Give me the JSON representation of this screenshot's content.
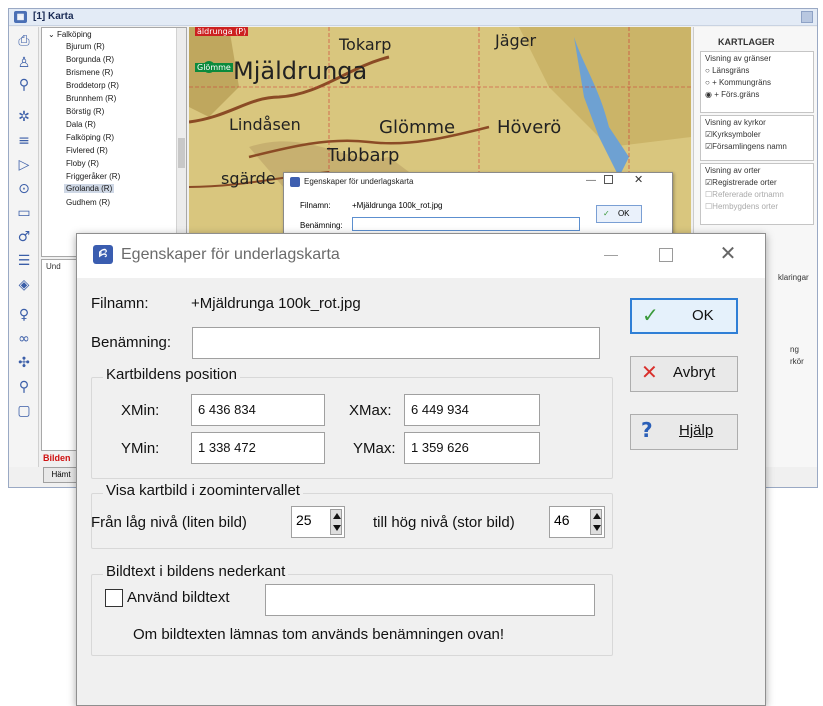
{
  "background_window": {
    "title": "[1] Karta",
    "tree": {
      "parent": "Falköping",
      "items": [
        "Bjurum (R)",
        "Borgunda (R)",
        "Brismene (R)",
        "Broddetorp (R)",
        "Brunnhem (R)",
        "Börstig (R)",
        "Dala (R)",
        "Falköping (R)",
        "Fivlered (R)",
        "Floby (R)",
        "Friggeråker (R)",
        "Grolanda (R)",
        "Gudhem (R)"
      ],
      "selected": "Grolanda (R)"
    },
    "panel2_label": "Und",
    "bottom_red_text": "Bilden",
    "hamta_button": "Hämt",
    "map_labels": [
      "äldrunga (P)",
      "Glömme",
      "Mjäldrunga",
      "Tokarp",
      "Jäger",
      "Lindåsen",
      "Glömme",
      "Höverö",
      "Tubbarp",
      "sgärde"
    ],
    "right_panel": {
      "heading": "KARTLAGER",
      "section1_title": "Visning av gränser",
      "radios": [
        "Länsgräns",
        "+ Kommungräns",
        "+ Förs.gräns"
      ],
      "radio_selected_index": 2,
      "section2_title": "Visning av kyrkor",
      "church_checks": [
        "Kyrksymboler",
        "Församlingens namn"
      ],
      "section3_title": "Visning av orter",
      "place_checks": [
        "Registrerade orter",
        "Refererade ortnamn",
        "Hembygdens orter"
      ],
      "truncated_1": "klaringar",
      "truncated_2": "ng",
      "truncated_3": "rkör"
    }
  },
  "small_dialog": {
    "title": "Egenskaper för underlagskarta",
    "filnamn_label": "Filnamn:",
    "filnamn_value": "+Mjäldrunga 100k_rot.jpg",
    "benamning_label": "Benämning:",
    "ok_label": "OK"
  },
  "dialog": {
    "title": "Egenskaper för underlagskarta",
    "app_icon": "ꗲ",
    "filnamn_label": "Filnamn:",
    "filnamn_value": "+Mjäldrunga 100k_rot.jpg",
    "benamning_label": "Benämning:",
    "benamning_value": "",
    "position_group": "Kartbildens position",
    "xmin_label": "XMin:",
    "xmin_value": "6 436 834",
    "xmax_label": "XMax:",
    "xmax_value": "6 449 934",
    "ymin_label": "YMin:",
    "ymin_value": "1 338 472",
    "ymax_label": "YMax:",
    "ymax_value": "1 359 626",
    "zoom_group": "Visa kartbild i zoomintervallet",
    "low_label": "Från låg nivå (liten bild)",
    "low_value": "25",
    "high_label": "till hög nivå (stor bild)",
    "high_value": "46",
    "caption_group": "Bildtext i bildens nederkant",
    "use_caption_label": "Använd bildtext",
    "use_caption_checked": false,
    "caption_value": "",
    "note": "Om bildtexten lämnas tom används benämningen ovan!",
    "ok_label": "OK",
    "cancel_label": "Avbryt",
    "help_label": "Hjälp"
  },
  "colors": {
    "accent": "#2f7fd6",
    "ok_check": "#3a9a3a",
    "cancel_x": "#d9302c",
    "help_q": "#2a5fb8",
    "map_base": "#d8c37a"
  }
}
